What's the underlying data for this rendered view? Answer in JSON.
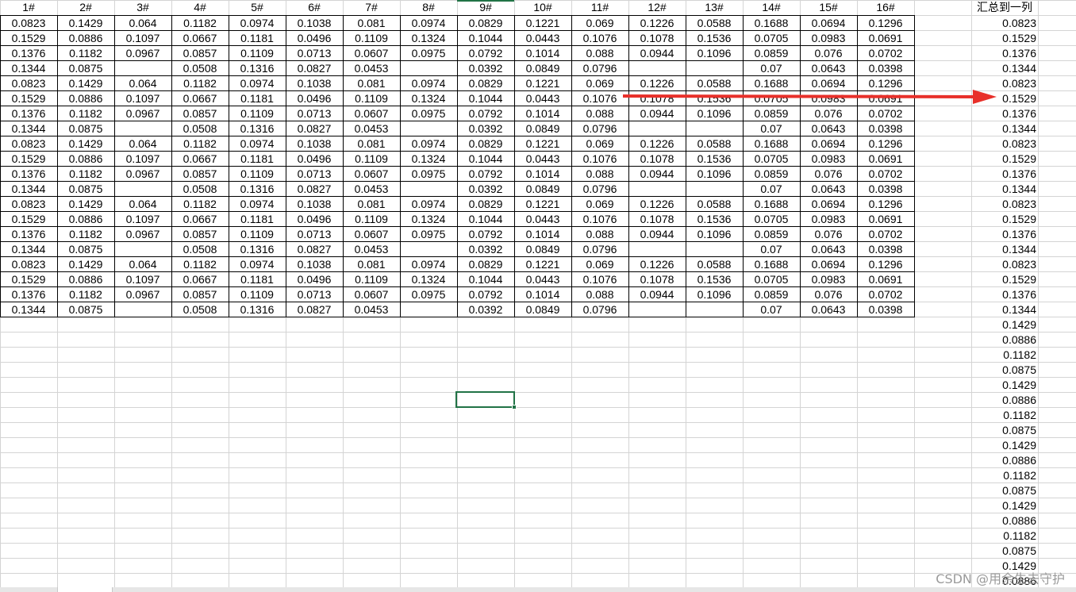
{
  "sheet": {
    "headers": [
      "1#",
      "2#",
      "3#",
      "4#",
      "5#",
      "6#",
      "7#",
      "8#",
      "9#",
      "10#",
      "11#",
      "12#",
      "13#",
      "14#",
      "15#",
      "16#"
    ],
    "summary_header": "汇总到一列",
    "block": [
      [
        "0.0823",
        "0.1429",
        "0.064",
        "0.1182",
        "0.0974",
        "0.1038",
        "0.081",
        "0.0974",
        "0.0829",
        "0.1221",
        "0.069",
        "0.1226",
        "0.0588",
        "0.1688",
        "0.0694",
        "0.1296"
      ],
      [
        "0.1529",
        "0.0886",
        "0.1097",
        "0.0667",
        "0.1181",
        "0.0496",
        "0.1109",
        "0.1324",
        "0.1044",
        "0.0443",
        "0.1076",
        "0.1078",
        "0.1536",
        "0.0705",
        "0.0983",
        "0.0691"
      ],
      [
        "0.1376",
        "0.1182",
        "0.0967",
        "0.0857",
        "0.1109",
        "0.0713",
        "0.0607",
        "0.0975",
        "0.0792",
        "0.1014",
        "0.088",
        "0.0944",
        "0.1096",
        "0.0859",
        "0.076",
        "0.0702"
      ],
      [
        "0.1344",
        "0.0875",
        "",
        "0.0508",
        "0.1316",
        "0.0827",
        "0.0453",
        "",
        "0.0392",
        "0.0849",
        "0.0796",
        "",
        "",
        "0.07",
        "0.0643",
        "0.0398"
      ]
    ],
    "block_repeats": 5,
    "summary_values": [
      "0.0823",
      "0.1529",
      "0.1376",
      "0.1344",
      "0.0823",
      "0.1529",
      "0.1376",
      "0.1344",
      "0.0823",
      "0.1529",
      "0.1376",
      "0.1344",
      "0.0823",
      "0.1529",
      "0.1376",
      "0.1344",
      "0.0823",
      "0.1529",
      "0.1376",
      "0.1344",
      "0.1429",
      "0.0886",
      "0.1182",
      "0.0875",
      "0.1429",
      "0.0886",
      "0.1182",
      "0.0875",
      "0.1429",
      "0.0886",
      "0.1182",
      "0.0875",
      "0.1429",
      "0.0886",
      "0.1182",
      "0.0875",
      "0.1429",
      "0.0886"
    ],
    "watermark": "CSDN @用余生去守护"
  },
  "colors": {
    "accent": "#217346",
    "arrow": "#e8302a",
    "gridline": "#d4d4d4"
  }
}
